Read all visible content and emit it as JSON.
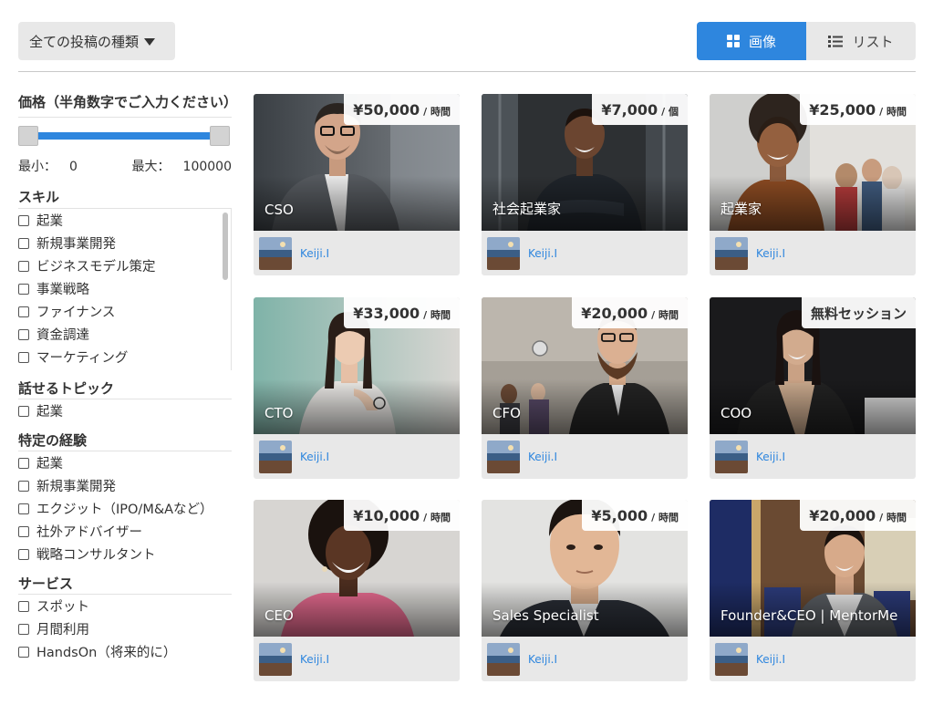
{
  "toolbar": {
    "post_type_label": "全ての投稿の種類",
    "view_image_label": "画像",
    "view_list_label": "リスト"
  },
  "colors": {
    "accent": "#2e86de",
    "link": "#2e86de",
    "panel": "#e8e8e8"
  },
  "filters": {
    "price": {
      "heading": "価格（半角数字でご入力ください）",
      "min_label": "最小：",
      "min_value": "0",
      "max_label": "最大：",
      "max_value": "100000"
    },
    "skills": {
      "title": "スキル",
      "items": [
        "起業",
        "新規事業開発",
        "ビジネスモデル策定",
        "事業戦略",
        "ファイナンス",
        "資金調達",
        "マーケティング"
      ]
    },
    "topics": {
      "title": "話せるトピック",
      "items": [
        "起業"
      ]
    },
    "experience": {
      "title": "特定の経験",
      "items": [
        "起業",
        "新規事業開発",
        "エクジット（IPO/M&Aなど）",
        "社外アドバイザー",
        "戦略コンサルタント"
      ]
    },
    "services": {
      "title": "サービス",
      "items": [
        "スポット",
        "月間利用",
        "HandsOn（将来的に）"
      ]
    }
  },
  "cards": [
    {
      "role": "CSO",
      "price": "¥50,000",
      "unit": "/ 時間",
      "author": "Keiji.I"
    },
    {
      "role": "社会起業家",
      "price": "¥7,000",
      "unit": "/ 個",
      "author": "Keiji.I"
    },
    {
      "role": "起業家",
      "price": "¥25,000",
      "unit": "/ 時間",
      "author": "Keiji.I"
    },
    {
      "role": "CTO",
      "price": "¥33,000",
      "unit": "/ 時間",
      "author": "Keiji.I"
    },
    {
      "role": "CFO",
      "price": "¥20,000",
      "unit": "/ 時間",
      "author": "Keiji.I"
    },
    {
      "role": "COO",
      "free_label": "無料セッション",
      "author": "Keiji.I"
    },
    {
      "role": "CEO",
      "price": "¥10,000",
      "unit": "/ 時間",
      "author": "Keiji.I"
    },
    {
      "role": "Sales Specialist",
      "price": "¥5,000",
      "unit": "/ 時間",
      "author": "Keiji.I"
    },
    {
      "role": "Founder&CEO | MentorMe",
      "price": "¥20,000",
      "unit": "/ 時間",
      "author": "Keiji.I"
    }
  ]
}
